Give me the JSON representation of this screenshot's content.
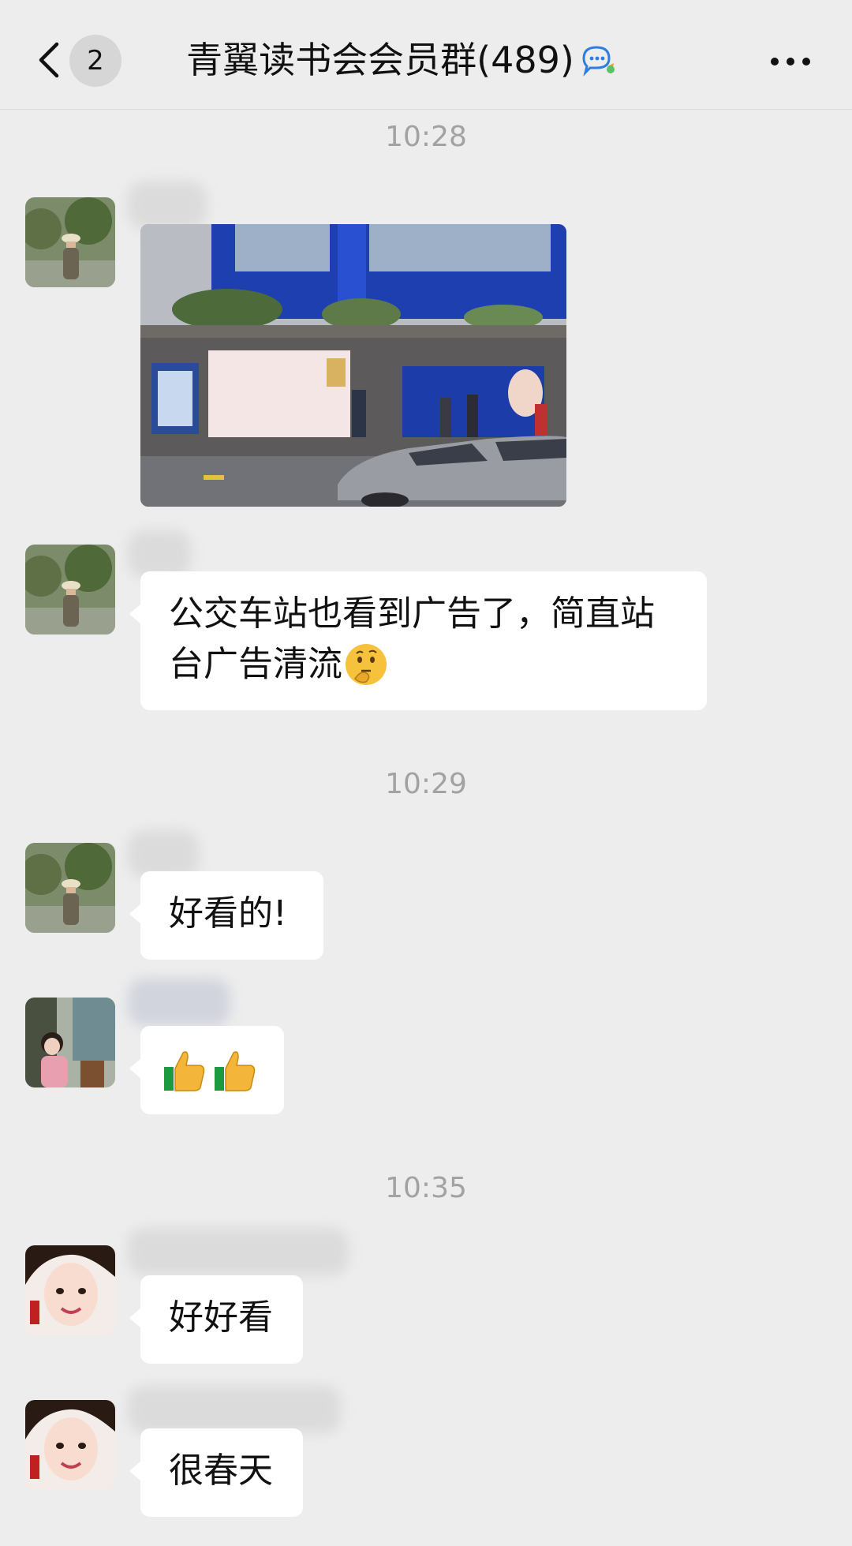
{
  "header": {
    "unread_count": "2",
    "title": "青翼读书会会员群(489)",
    "back_icon": "chevron-left-icon",
    "group_icon": "group-chat-icon",
    "more_icon": "more-dots-icon"
  },
  "messages": [
    {
      "type": "timestamp",
      "text": "10:28"
    },
    {
      "type": "image",
      "sender": "member-a",
      "description_icon": "photo-bus-stop"
    },
    {
      "type": "text",
      "sender": "member-a",
      "text_line1": "公交车站也看到广告了，简直站",
      "text_line2": "台广告清流",
      "emoji": "thinking-face-icon"
    },
    {
      "type": "timestamp",
      "text": "10:29"
    },
    {
      "type": "text",
      "sender": "member-a",
      "text": "好看的!"
    },
    {
      "type": "emoji",
      "sender": "member-b",
      "emoji": "thumbs-up-icon"
    },
    {
      "type": "timestamp",
      "text": "10:35"
    },
    {
      "type": "text",
      "sender": "member-c",
      "text": "好好看"
    },
    {
      "type": "text",
      "sender": "member-c",
      "text": "很春天"
    }
  ],
  "colors": {
    "background": "#ededed",
    "bubble": "#ffffff",
    "timestamp": "#a2a2a2",
    "text": "#111111"
  }
}
